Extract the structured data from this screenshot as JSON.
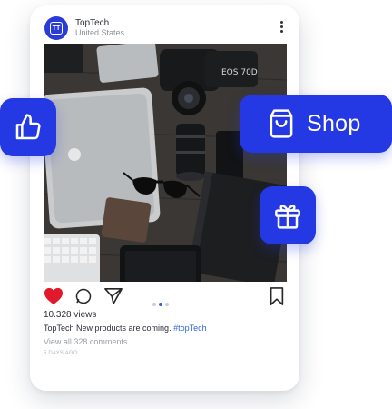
{
  "post": {
    "account_name": "TopTech",
    "location": "United States",
    "avatar_text": "TT",
    "views": "10.328 views",
    "caption_text": "TopTech New products are coming.",
    "caption_hashtag": "#topTech",
    "comments_link": "View all 328 comments",
    "time_ago": "5 DAYS AGO",
    "carousel": {
      "total": 3,
      "active": 2
    },
    "liked": true
  },
  "photo": {
    "camera_badge": "EOS 70D"
  },
  "floating_actions": {
    "shop_label": "Shop"
  },
  "icons": {
    "menu": "more-vertical-icon",
    "heart": "heart-icon",
    "comment": "comment-icon",
    "share": "send-icon",
    "bookmark": "bookmark-icon",
    "like": "thumbs-up-icon",
    "shop": "shopping-bag-icon",
    "gift": "gift-icon"
  },
  "colors": {
    "accent": "#2438e4",
    "heart": "#e0192b",
    "hashtag": "#2f64d8"
  }
}
